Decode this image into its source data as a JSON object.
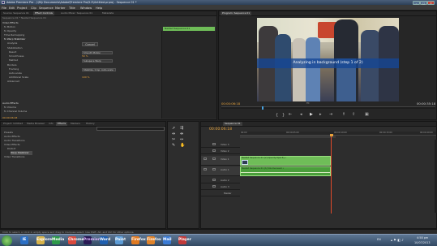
{
  "app": {
    "title": "Adobe Premiere Pro - J:\\My Documents\\Adobe\\Premiere Pro\\5.0\\Untitled.prproj - Sequence 01 *",
    "window_buttons": [
      "–",
      "□",
      "✕"
    ]
  },
  "menu": [
    "File",
    "Edit",
    "Project",
    "Clip",
    "Sequence",
    "Marker",
    "Title",
    "Window",
    "Help"
  ],
  "effect_controls": {
    "tabs": [
      "Source: Sequence 01",
      "Effect Controls",
      "Audio Mixer: Sequence 01",
      "Metadata"
    ],
    "header": "Sequence 01 * Nested Sequence 01",
    "clip_chip": "Nested Sequence 01",
    "sections": {
      "video_effects": "Video Effects",
      "motion": "fx Motion",
      "opacity": "fx Opacity",
      "time_remapping": "Time Remapping",
      "warp_stabilizer": "fx Warp Stabilizer",
      "audio_effects": "Audio Effects",
      "volume": "fx Volume",
      "channel_volume": "fx Channel Volume"
    },
    "rows": [
      {
        "label": "Analysis",
        "value": ""
      },
      {
        "label": "Stabilization",
        "value": ""
      },
      {
        "label": "Result",
        "value": "Smooth Motion"
      },
      {
        "label": "Smoothness",
        "value": "50 %"
      },
      {
        "label": "Method",
        "value": "Subspace Warp"
      },
      {
        "label": "Borders",
        "value": ""
      },
      {
        "label": "Framing",
        "value": "Stabilize, Crop, Auto-scale"
      },
      {
        "label": "Auto-scale",
        "value": ""
      },
      {
        "label": "Additional Scale",
        "value": "100 %"
      },
      {
        "label": "Advanced",
        "value": ""
      }
    ],
    "cancel_label": "Cancel",
    "timecode": "00:00:06:18"
  },
  "program_monitor": {
    "tab": "Program: Sequence 01",
    "overlay_text": "Analyzing in background (step 1 of 2)",
    "timecode_left": "00:00:06:18",
    "timecode_right": "00:00:35:18",
    "fit_label": "Fit"
  },
  "effects_panel": {
    "tabs": [
      "Project: Untitled",
      "Media Browser",
      "Info",
      "Effects",
      "Markers",
      "History"
    ],
    "items": [
      {
        "label": "Presets",
        "indent": 0
      },
      {
        "label": "Audio Effects",
        "indent": 0
      },
      {
        "label": "Audio Transitions",
        "indent": 0
      },
      {
        "label": "Video Effects",
        "indent": 0
      },
      {
        "label": "Distort",
        "indent": 1
      },
      {
        "label": "Warp Stabilizer",
        "indent": 2,
        "selected": true
      },
      {
        "label": "Video Transitions",
        "indent": 0
      }
    ]
  },
  "timeline": {
    "tab": "Sequence 01",
    "timecode": "00:00:06:18",
    "ruler": [
      "00:00",
      "00:00:05:00",
      "00:00:10:00",
      "00:00:15:00",
      "00:00:20:00"
    ],
    "tracks": [
      {
        "name": "Video 3",
        "type": "video",
        "clip": ""
      },
      {
        "name": "Video 2",
        "type": "video",
        "clip": ""
      },
      {
        "name": "Video 1",
        "type": "video",
        "clip": "Nested Sequence 01 [V]  Opacity:Opacity •"
      },
      {
        "name": "Audio 1",
        "type": "audio",
        "clip": "Nested Sequence 01 [A]  Volume:Level •"
      },
      {
        "name": "Audio 2",
        "type": "audio",
        "clip": ""
      },
      {
        "name": "Audio 3",
        "type": "audio",
        "clip": ""
      },
      {
        "name": "Master",
        "type": "master",
        "clip": ""
      }
    ]
  },
  "status_bar": "Click to select, or click in empty space and drag to marquee select. Use Shift, Alt, and Ctrl for other options.",
  "taskbar": {
    "apps": [
      "IE",
      "Explorer",
      "Media",
      "Chrome",
      "Premiere",
      "Word",
      "Paint",
      "Firefox",
      "Firefox",
      "Mail",
      "Player"
    ],
    "language": "EN",
    "time": "4:58 pm",
    "date": "10/07/2013"
  },
  "colors": {
    "accent_timecode": "#e6a23c",
    "clip_green": "#6fbd58",
    "playhead_red": "#e04a2a"
  }
}
